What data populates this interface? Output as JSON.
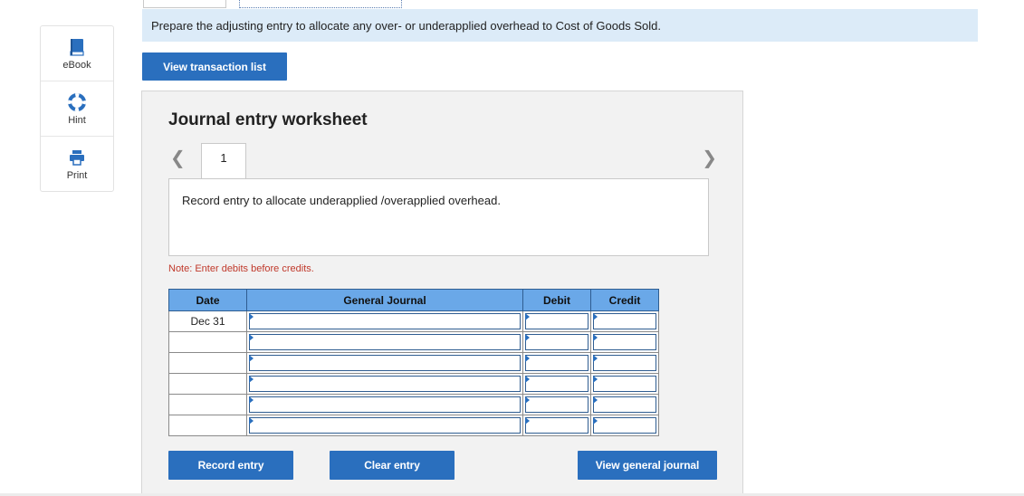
{
  "sidebar": {
    "items": [
      {
        "label": "eBook",
        "icon": "book-icon"
      },
      {
        "label": "Hint",
        "icon": "lifebuoy-icon"
      },
      {
        "label": "Print",
        "icon": "printer-icon"
      }
    ]
  },
  "instruction": "Prepare the adjusting entry to allocate any over- or underapplied overhead to Cost of Goods Sold.",
  "buttons": {
    "view_transaction_list": "View transaction list",
    "record_entry": "Record entry",
    "clear_entry": "Clear entry",
    "view_general_journal": "View general journal"
  },
  "worksheet": {
    "title": "Journal entry worksheet",
    "current_tab": "1",
    "entry_description": "Record entry to allocate underapplied /overapplied overhead.",
    "note": "Note: Enter debits before credits.",
    "columns": [
      "Date",
      "General Journal",
      "Debit",
      "Credit"
    ],
    "rows": [
      {
        "date": "Dec 31",
        "account": "",
        "debit": "",
        "credit": ""
      },
      {
        "date": "",
        "account": "",
        "debit": "",
        "credit": ""
      },
      {
        "date": "",
        "account": "",
        "debit": "",
        "credit": ""
      },
      {
        "date": "",
        "account": "",
        "debit": "",
        "credit": ""
      },
      {
        "date": "",
        "account": "",
        "debit": "",
        "credit": ""
      },
      {
        "date": "",
        "account": "",
        "debit": "",
        "credit": ""
      }
    ]
  },
  "colors": {
    "accent": "#2a6fbe",
    "instruction_bg": "#dcebf8",
    "table_header": "#6aa8e8",
    "note": "#c0392b"
  }
}
